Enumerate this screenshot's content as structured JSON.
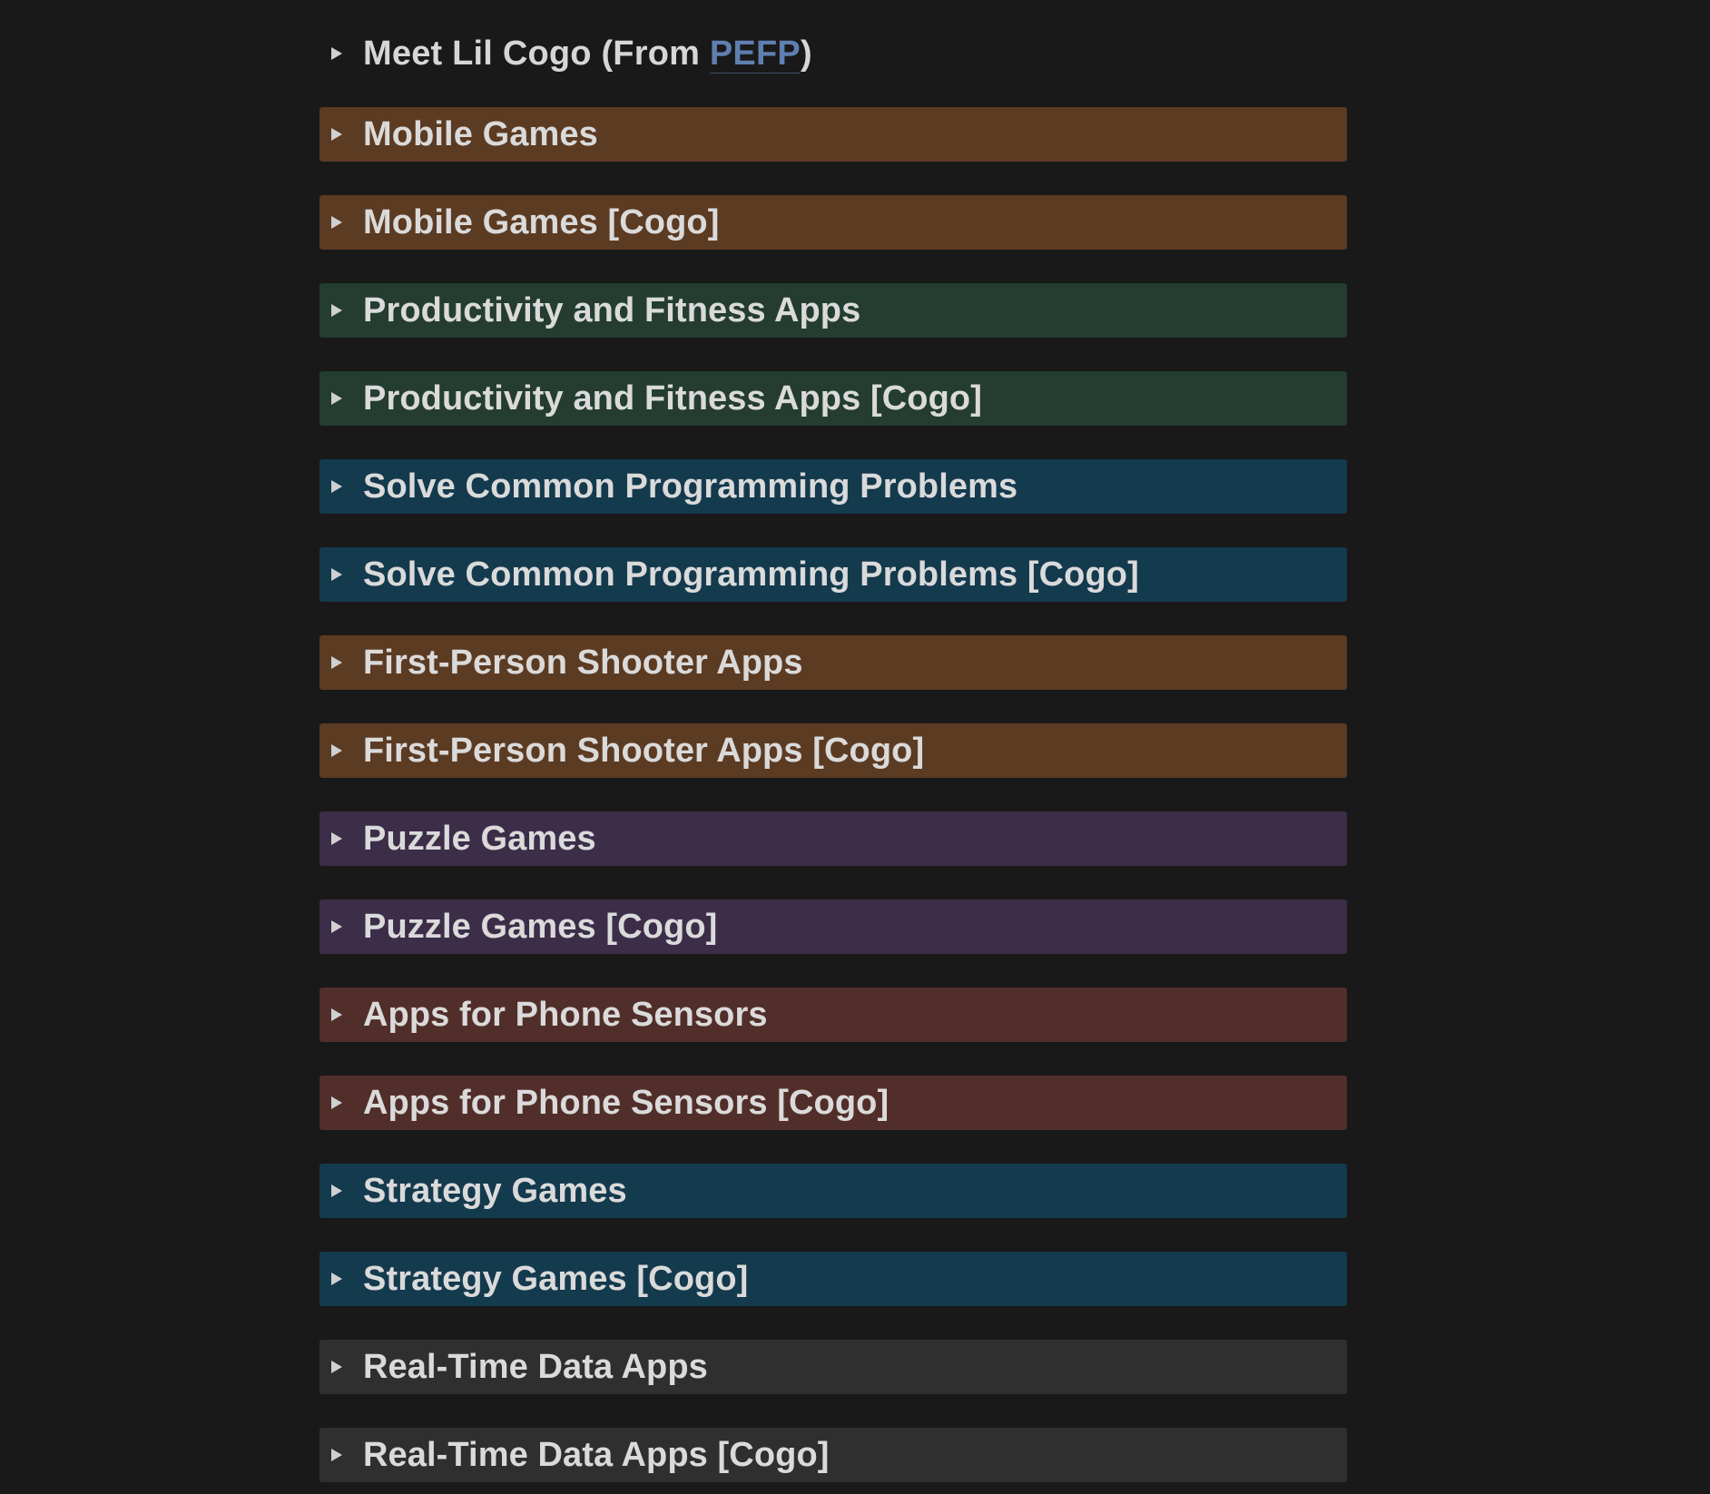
{
  "intro": {
    "prefix": "Meet Lil Cogo (From ",
    "link": "PEFP",
    "suffix": ")"
  },
  "colors": {
    "brown": "#5c3b23",
    "green": "#243d30",
    "blue": "#143a4e",
    "purple": "#3c2d49",
    "red": "#522e2a",
    "gray": "#2f2f2f",
    "link": "#5f7fb0"
  },
  "toggles": [
    {
      "label": "Mobile Games",
      "color": "brown"
    },
    {
      "label": "Mobile Games [Cogo]",
      "color": "brown"
    },
    {
      "label": "Productivity and Fitness Apps",
      "color": "green"
    },
    {
      "label": "Productivity and Fitness Apps [Cogo]",
      "color": "green"
    },
    {
      "label": "Solve Common Programming Problems",
      "color": "blue"
    },
    {
      "label": "Solve Common Programming Problems [Cogo]",
      "color": "blue"
    },
    {
      "label": "First-Person Shooter Apps",
      "color": "brown"
    },
    {
      "label": "First-Person Shooter Apps [Cogo]",
      "color": "brown"
    },
    {
      "label": "Puzzle Games",
      "color": "purple"
    },
    {
      "label": "Puzzle Games [Cogo]",
      "color": "purple"
    },
    {
      "label": "Apps for Phone Sensors",
      "color": "red"
    },
    {
      "label": "Apps for Phone Sensors [Cogo]",
      "color": "red"
    },
    {
      "label": "Strategy Games",
      "color": "blue"
    },
    {
      "label": "Strategy Games [Cogo]",
      "color": "blue"
    },
    {
      "label": "Real-Time Data Apps",
      "color": "gray"
    },
    {
      "label": "Real-Time Data Apps [Cogo]",
      "color": "gray"
    }
  ],
  "icons": {
    "toggle": "triangle-right-icon"
  }
}
